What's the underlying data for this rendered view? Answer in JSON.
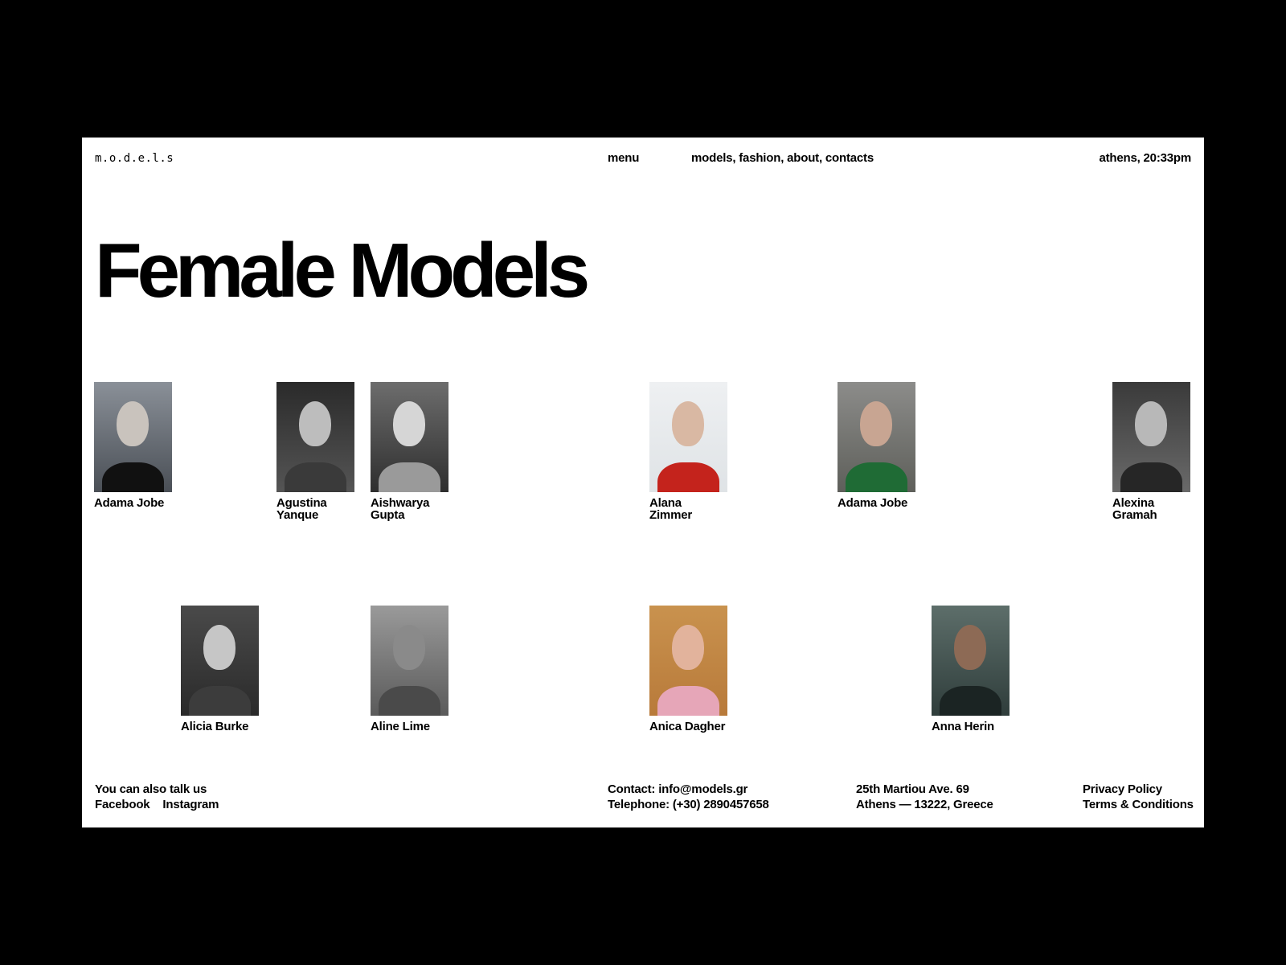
{
  "header": {
    "logo": "m.o.d.e.l.s",
    "menu_label": "menu",
    "nav_links": [
      "models",
      "fashion",
      "about",
      "contacts"
    ],
    "location_time": "athens, 20:33pm"
  },
  "page_title": "Female Models",
  "models": [
    {
      "first": "Adama Jobe",
      "last": ""
    },
    {
      "first": "Agustina",
      "last": "Yanque"
    },
    {
      "first": "Aishwarya",
      "last": "Gupta"
    },
    {
      "first": "Alana",
      "last": "Zimmer"
    },
    {
      "first": "Adama Jobe",
      "last": ""
    },
    {
      "first": "Alexina",
      "last": "Gramah"
    },
    {
      "first": "Alicia Burke",
      "last": ""
    },
    {
      "first": "Aline Lime",
      "last": ""
    },
    {
      "first": "Anica Dagher",
      "last": ""
    },
    {
      "first": "Anna Herin",
      "last": ""
    }
  ],
  "footer": {
    "social_heading": "You can also talk us",
    "facebook": "Facebook",
    "instagram": "Instagram",
    "contact_email": "Contact: info@models.gr",
    "telephone": "Telephone: (+30) 2890457658",
    "address_line1": "25th Martiou Ave. 69",
    "address_line2": "Athens — 13222, Greece",
    "privacy": "Privacy Policy",
    "terms": "Terms & Conditions"
  },
  "colors": {
    "frame": "#000000",
    "page": "#ffffff",
    "text": "#000000"
  }
}
